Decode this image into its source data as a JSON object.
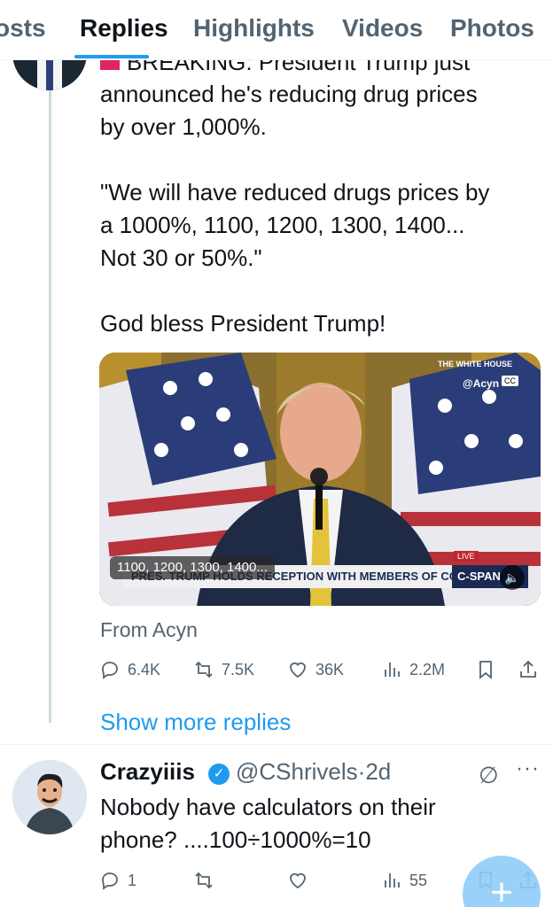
{
  "tabs": [
    {
      "label": "osts",
      "active": false
    },
    {
      "label": "Replies",
      "active": true
    },
    {
      "label": "Highlights",
      "active": false
    },
    {
      "label": "Videos",
      "active": false
    },
    {
      "label": "Photos",
      "active": false
    }
  ],
  "tweet": {
    "clipped_first_line": "BREAKING: President Trump just",
    "lines": [
      "announced he's reducing drug prices",
      "by over 1,000%.",
      "\"We will have reduced drugs prices by",
      "a 1000%, 1100, 1200, 1300, 1400...",
      "Not 30 or 50%.\"",
      "God bless President Trump!"
    ],
    "media": {
      "caption": "1100, 1200, 1300, 1400...",
      "banner": "PRES. TRUMP HOLDS RECEPTION WITH MEMBERS OF CONGRESS",
      "network": "C-SPAN",
      "live": "LIVE",
      "white_house": "THE WHITE HOUSE",
      "watermark": "@Acyn",
      "cc": "CC"
    },
    "from": "From Acyn",
    "stats": {
      "replies": "6.4K",
      "reposts": "7.5K",
      "likes": "36K",
      "views": "2.2M"
    }
  },
  "show_more": "Show more replies",
  "reply": {
    "name": "Crazyiiis",
    "handle": "@CShrivels",
    "time": "2d",
    "lines": [
      "Nobody have calculators on their",
      "phone? ....100÷1000%=10"
    ],
    "stats": {
      "replies": "1",
      "reposts": "",
      "likes": "",
      "views": "55"
    }
  },
  "colors": {
    "accent": "#1d9bf0",
    "muted": "#536471",
    "text": "#0f1419"
  }
}
